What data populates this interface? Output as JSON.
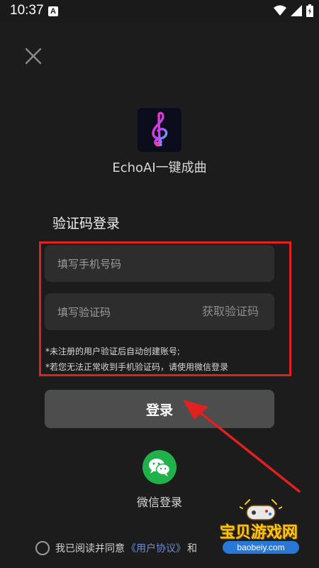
{
  "status_bar": {
    "time": "10:37",
    "notification_badge": "A"
  },
  "app": {
    "name": "EchoAI一键成曲"
  },
  "login": {
    "title": "验证码登录",
    "phone_placeholder": "填写手机号码",
    "code_placeholder": "填写验证码",
    "get_code_label": "获取验证码",
    "hint_1": "*未注册的用户验证后自动创建账号;",
    "hint_2": "*若您无法正常收到手机验证码，请使用微信登录",
    "submit_label": "登录"
  },
  "wechat": {
    "label": "微信登录"
  },
  "agreement": {
    "text": "我已阅读并同意",
    "link_user": "《用户协议》",
    "and": "和"
  },
  "watermark": {
    "title": "宝贝游戏网",
    "url": "baobeiy.com"
  },
  "colors": {
    "background": "#1c1c1c",
    "highlight": "#e12020",
    "wechat_green": "#20b24a",
    "link_blue": "#6b8cdc"
  }
}
